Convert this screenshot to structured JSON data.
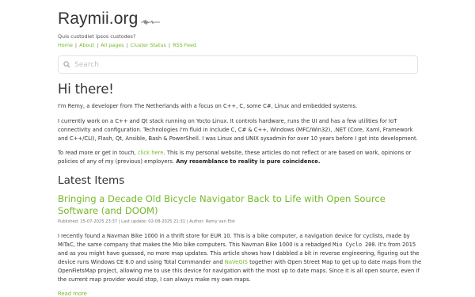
{
  "site": {
    "title": "Raymii.org",
    "tagline": "Quis custodiet ipsos custodes?"
  },
  "nav": {
    "items": [
      {
        "label": "Home"
      },
      {
        "label": "About"
      },
      {
        "label": "All pages"
      },
      {
        "label": "Cluster Status"
      },
      {
        "label": "RSS Feed"
      }
    ],
    "separator": "|"
  },
  "search": {
    "placeholder": "Search"
  },
  "intro": {
    "heading": "Hi there!",
    "p1": "I'm Remy, a developer from The Netherlands with a focus on C++, C, some C#, Linux and embedded systems.",
    "p2": "I currently work on a C++ and Qt stack running on Yocto Linux. It controls hardware, runs the UI and has a few utilities for IoT connectivity and configuration. Technologies I'm fluid in include C, C# & C++, Windows (MFC/Win32), .NET (Core, Xaml, Framework and C++/CLI), Flash, Qt, Ansible, Bash & PowerShell. I was Linux and UNIX sysadmin for over 10 years before I got into development.",
    "p3_before": "To read more or get in touch, ",
    "p3_link": "click here",
    "p3_middle": ". This is my personal website, these articles do not reflect or are based on work, opinions or policies of any of my (previous) employers. ",
    "p3_bold": "Any resemblance to reality is pure coincidence."
  },
  "latest": {
    "heading": "Latest Items",
    "article": {
      "title": "Bringing a Decade Old Bicycle Navigator Back to Life with Open Source Software (and DOOM)",
      "published": "Published: 25-07-2025 23:37",
      "updated": "Last update: 02-08-2025 21:31",
      "author": "Author: Remy van Elst",
      "meta_sep": " | ",
      "body_1": "I recently found a Navman Bike 1000 in a thrift store for EUR 10. This is a bike computer, a navigation device for cyclists, made by MiTaC, the same company that makes the Mio bike computers. This Navman Bike 1000 is a rebadged ",
      "body_code": "Mio Cyclo 200",
      "body_2": ". It's from 2015 and as you might have guessed, no more map updates. This article shows how I dabbled a bit in reverse engineering, figuring out the device runs Windows CE 6.0 and using Total Commander and ",
      "body_link": "NaVeGIS",
      "body_3": " together with Open Street Map to get up to date maps from the OpenFietsMap project, allowing me to use this device for navigation with the most up to date maps. Since it is all open source, even if the current map provider would stop, I can always make my own maps.",
      "read_more": "Read more"
    }
  },
  "colors": {
    "accent": "#76b82a",
    "text": "#333333",
    "muted": "#777777"
  }
}
